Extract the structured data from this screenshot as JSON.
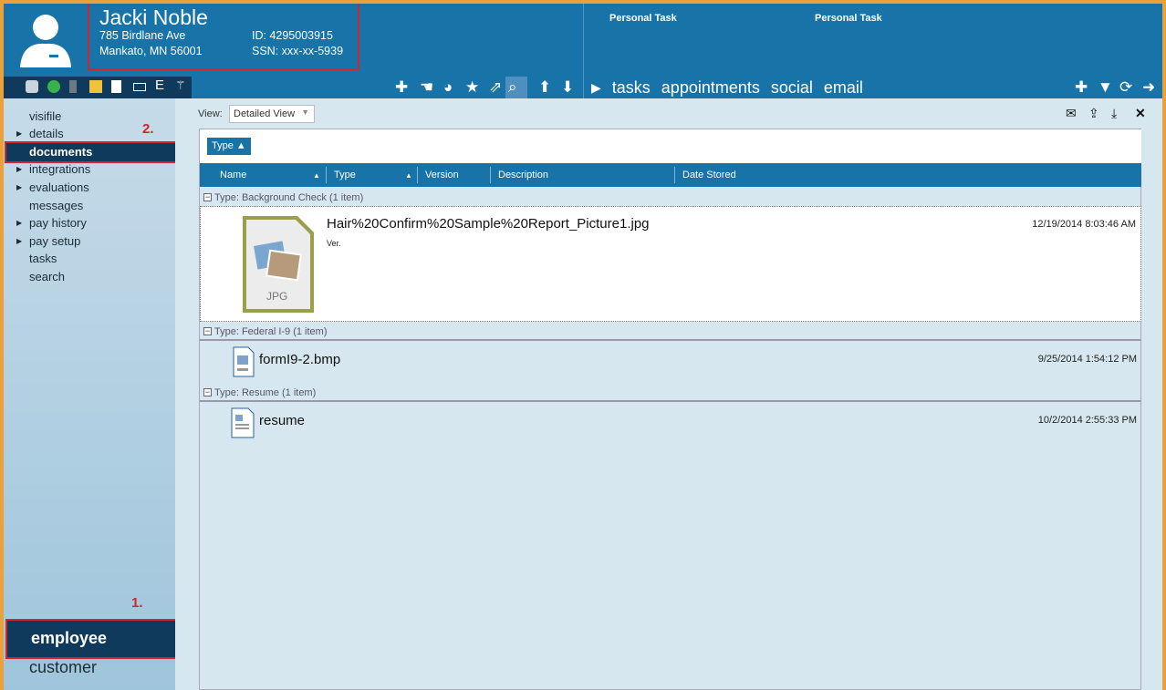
{
  "employee": {
    "name": "Jacki Noble",
    "street": "785 Birdlane Ave",
    "city": "Mankato, MN 56001",
    "id": "ID: 4295003915",
    "ssn": "SSN: xxx-xx-5939"
  },
  "header": {
    "task_a": "Personal Task",
    "task_b": "Personal Task",
    "tabs": [
      "tasks",
      "appointments",
      "social",
      "email"
    ]
  },
  "sidebar": {
    "items": [
      {
        "label": "visifile",
        "arrow": false
      },
      {
        "label": "details",
        "arrow": true
      },
      {
        "label": "documents",
        "arrow": false
      },
      {
        "label": "integrations",
        "arrow": true
      },
      {
        "label": "evaluations",
        "arrow": true
      },
      {
        "label": "messages",
        "arrow": false
      },
      {
        "label": "pay history",
        "arrow": true
      },
      {
        "label": "pay setup",
        "arrow": true
      },
      {
        "label": "tasks",
        "arrow": false
      },
      {
        "label": "search",
        "arrow": false
      }
    ],
    "modules": [
      "employee",
      "customer"
    ]
  },
  "annotations": {
    "one": "1.",
    "two": "2."
  },
  "view": {
    "label": "View:",
    "selected": "Detailed View"
  },
  "grid": {
    "group_button": "Type",
    "columns": [
      "Name",
      "Type",
      "Version",
      "Description",
      "Date Stored"
    ],
    "groups": [
      {
        "title": "Type: Background Check (1 item)",
        "file": "Hair%20Confirm%20Sample%20Report_Picture1.jpg",
        "sub": "Ver.",
        "date": "12/19/2014 8:03:46 AM",
        "thumb": "JPG"
      },
      {
        "title": "Type: Federal I-9 (1 item)",
        "file": "formI9-2.bmp",
        "date": "9/25/2014 1:54:12 PM"
      },
      {
        "title": "Type: Resume (1 item)",
        "file": "resume",
        "date": "10/2/2014 2:55:33 PM"
      }
    ]
  },
  "colors": {
    "header": "#1773a8",
    "dark": "#0f3a5c",
    "highlight": "#d3262c"
  }
}
